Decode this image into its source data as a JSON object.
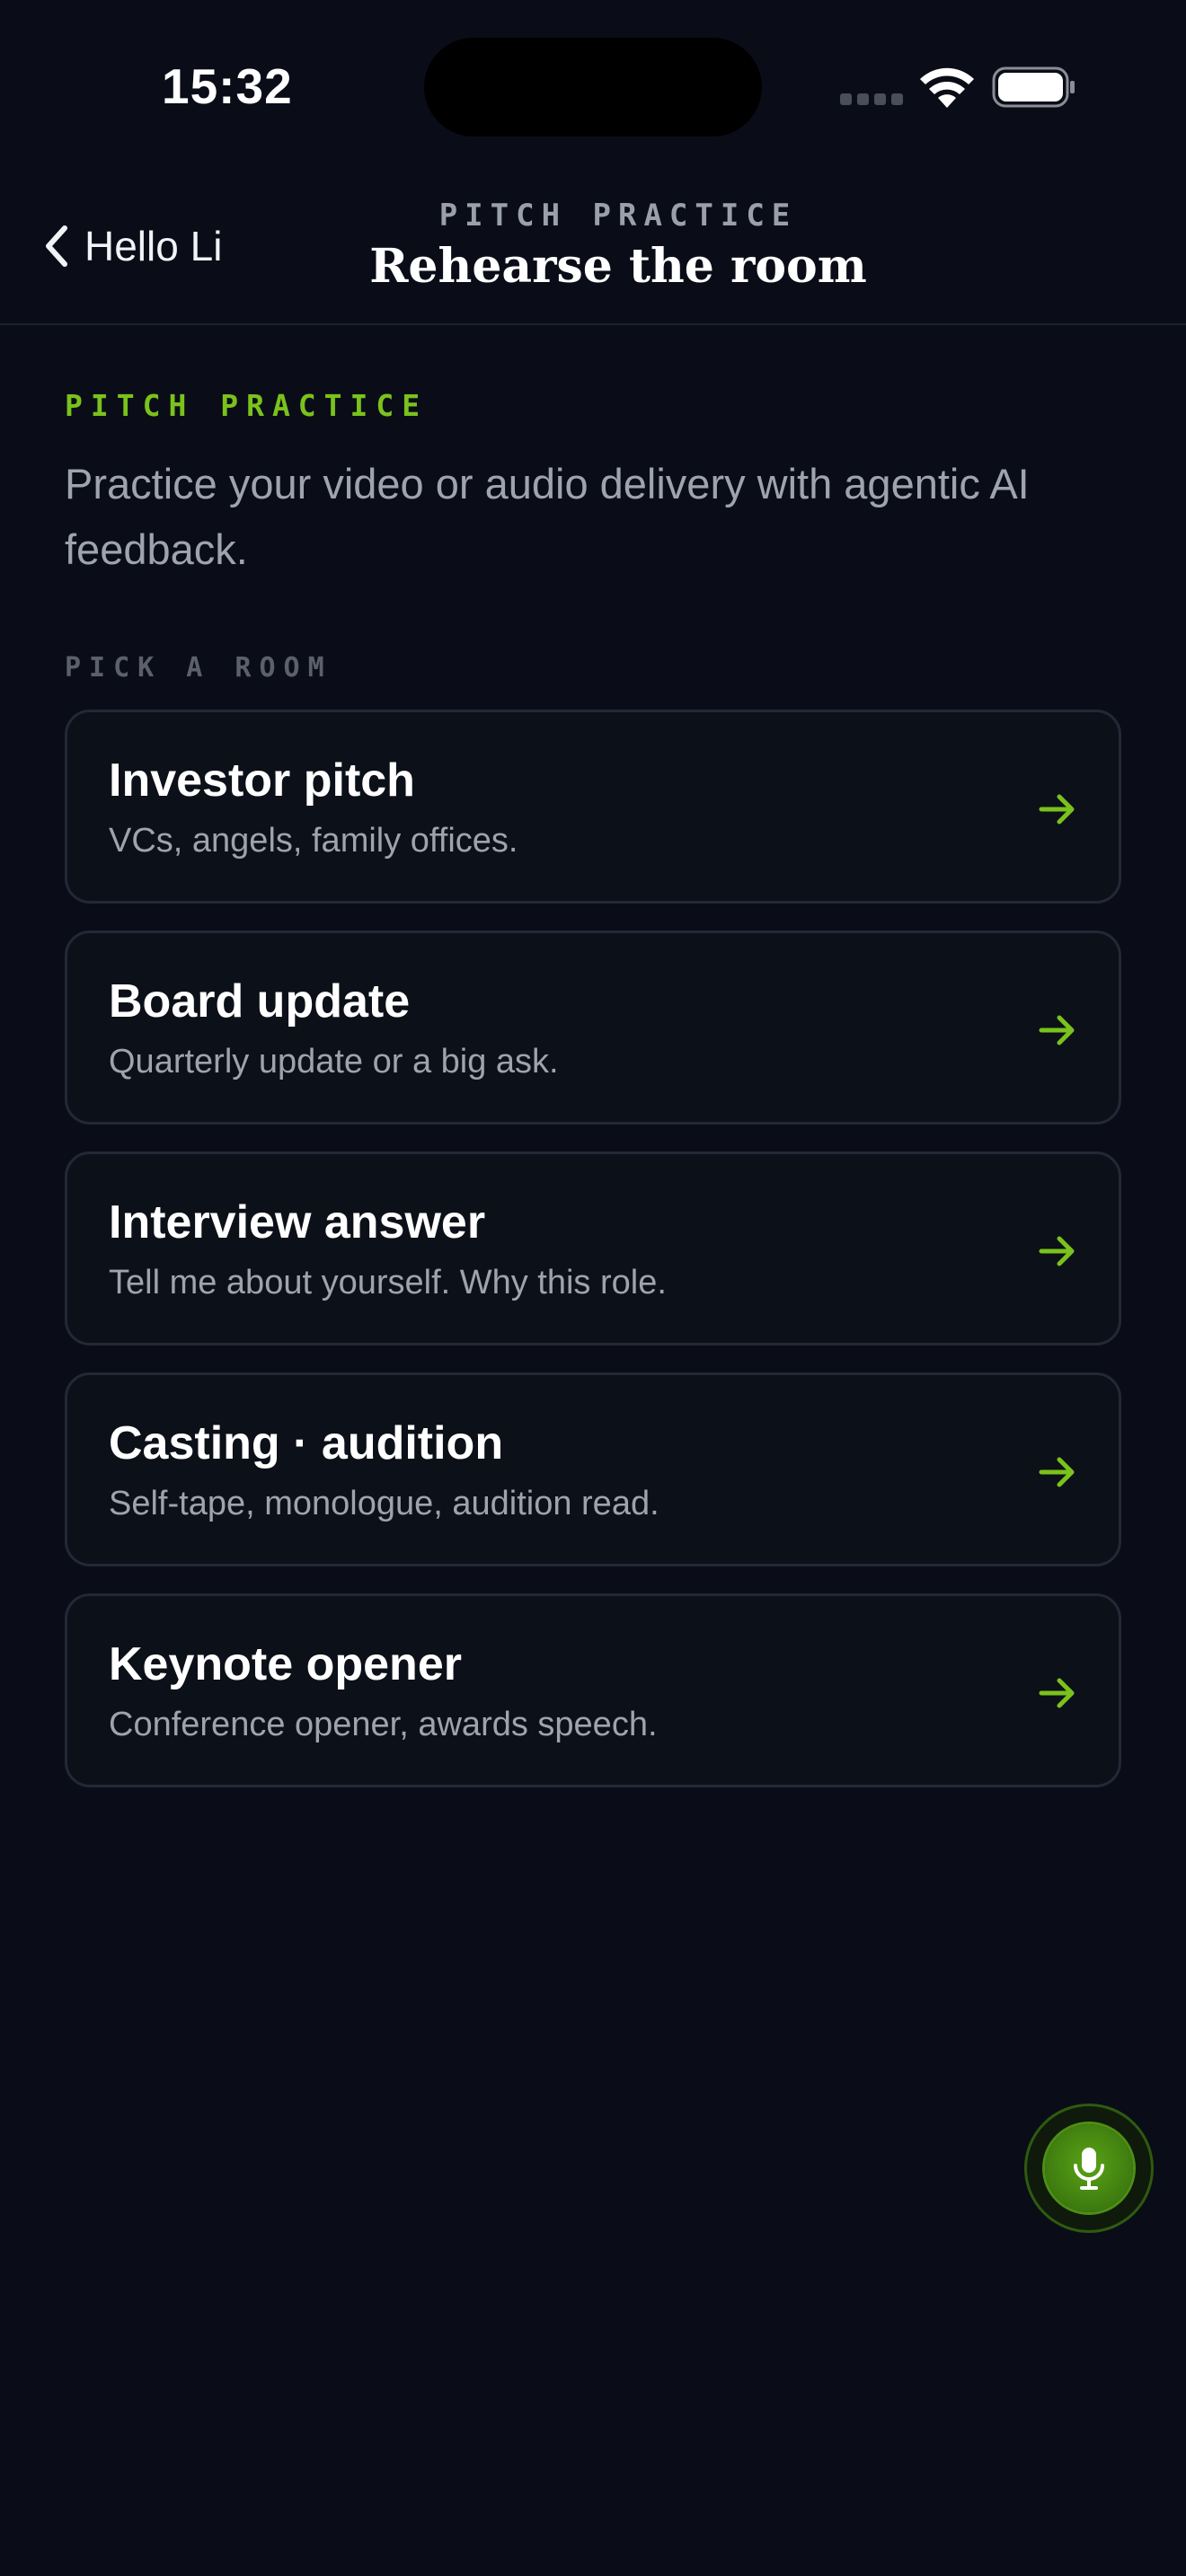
{
  "status_bar": {
    "time": "15:32"
  },
  "nav": {
    "back_label": "Hello Li",
    "eyebrow": "PITCH PRACTICE",
    "title": "Rehearse the room"
  },
  "content": {
    "eyebrow": "PITCH PRACTICE",
    "intro": "Practice your video or audio delivery with agentic AI feedback.",
    "pick_label": "PICK A ROOM",
    "rooms": [
      {
        "title": "Investor pitch",
        "subtitle": "VCs, angels, family offices."
      },
      {
        "title": "Board update",
        "subtitle": "Quarterly update or a big ask."
      },
      {
        "title": "Interview answer",
        "subtitle": "Tell me about yourself. Why this role."
      },
      {
        "title": "Casting · audition",
        "subtitle": "Self-tape, monologue, audition read."
      },
      {
        "title": "Keynote opener",
        "subtitle": "Conference opener, awards speech."
      }
    ]
  },
  "icons": {
    "back": "chevron-left-icon",
    "room_arrow": "arrow-right-icon",
    "mic": "microphone-icon"
  },
  "colors": {
    "background": "#0a0d17",
    "accent": "#7ac21c",
    "card_border": "#242836"
  }
}
